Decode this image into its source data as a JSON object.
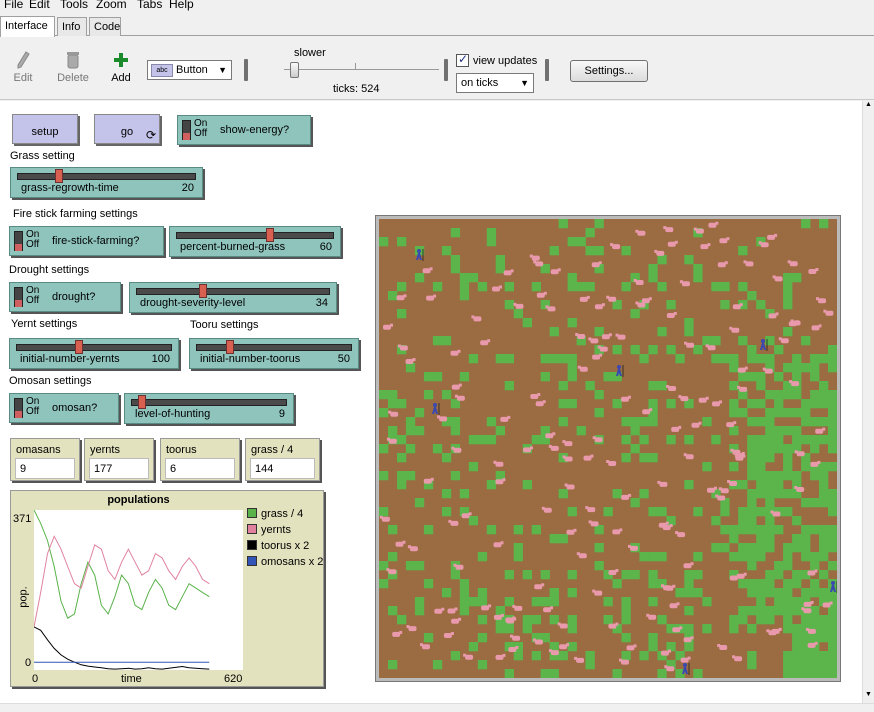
{
  "menu": [
    "File",
    "Edit",
    "Tools",
    "Zoom",
    "Tabs",
    "Help"
  ],
  "tabs": [
    {
      "label": "Interface",
      "active": true
    },
    {
      "label": "Info"
    },
    {
      "label": "Code"
    }
  ],
  "toolbar": {
    "edit_label": "Edit",
    "delete_label": "Delete",
    "add_label": "Add",
    "widget_type": "Button",
    "speed_label": "slower",
    "ticks_text": "ticks: 524",
    "view_updates_label": "view updates",
    "view_updates_checked": true,
    "update_mode": "on ticks",
    "settings_label": "Settings..."
  },
  "buttons": {
    "setup": "setup",
    "go": "go"
  },
  "switches": {
    "show_energy": {
      "label": "show-energy?",
      "on": "On",
      "off": "Off"
    },
    "fire_stick": {
      "label": "fire-stick-farming?",
      "on": "On",
      "off": "Off"
    },
    "drought": {
      "label": "drought?",
      "on": "On",
      "off": "Off"
    },
    "omosan": {
      "label": "omosan?",
      "on": "On",
      "off": "Off"
    }
  },
  "notes": {
    "grass": "Grass setting",
    "fire": "Fire stick farming settings",
    "drought": "Drought settings",
    "yernt": "Yernt settings",
    "tooru": "Tooru settings",
    "omosan": "Omosan settings"
  },
  "sliders": {
    "grass_regrowth": {
      "name": "grass-regrowth-time",
      "value": "20",
      "fraction": 0.22
    },
    "percent_burned": {
      "name": "percent-burned-grass",
      "value": "60",
      "fraction": 0.6
    },
    "drought_severity": {
      "name": "drought-severity-level",
      "value": "34",
      "fraction": 0.34
    },
    "init_yernts": {
      "name": "initial-number-yernts",
      "value": "100",
      "fraction": 0.4
    },
    "init_toorus": {
      "name": "initial-number-toorus",
      "value": "50",
      "fraction": 0.2
    },
    "hunting": {
      "name": "level-of-hunting",
      "value": "9",
      "fraction": 0.05
    }
  },
  "monitors": [
    {
      "name": "omasans",
      "value": "9"
    },
    {
      "name": "yernts",
      "value": "177"
    },
    {
      "name": "toorus",
      "value": "6"
    },
    {
      "name": "grass / 4",
      "value": "144"
    }
  ],
  "plot": {
    "title": "populations",
    "ylabel": "pop.",
    "xlabel": "time",
    "y_max_label": "371",
    "y_min_label": "0",
    "x_min_label": "0",
    "x_max_label": "620",
    "legend": [
      {
        "name": "grass / 4",
        "color": "#59b24a"
      },
      {
        "name": "yernts",
        "color": "#e0829e"
      },
      {
        "name": "toorus x 2",
        "color": "#000000"
      },
      {
        "name": "omosans x 2",
        "color": "#3455b8"
      }
    ]
  },
  "chart_data": {
    "type": "line",
    "ylim": [
      0,
      371
    ],
    "xlim": [
      0,
      620
    ],
    "series": [
      {
        "name": "grass / 4",
        "color": "#59b24a",
        "x": [
          0,
          20,
          40,
          60,
          80,
          100,
          120,
          140,
          160,
          180,
          200,
          220,
          240,
          260,
          280,
          300,
          320,
          340,
          360,
          380,
          400,
          420,
          440,
          460,
          480,
          500,
          520
        ],
        "values": [
          371,
          340,
          300,
          240,
          160,
          120,
          130,
          200,
          250,
          220,
          150,
          130,
          170,
          220,
          200,
          150,
          140,
          180,
          210,
          190,
          150,
          140,
          170,
          200,
          190,
          180,
          170
        ]
      },
      {
        "name": "yernts",
        "color": "#e0829e",
        "x": [
          0,
          20,
          40,
          60,
          80,
          100,
          120,
          140,
          160,
          180,
          200,
          220,
          240,
          260,
          280,
          300,
          320,
          340,
          360,
          380,
          400,
          420,
          440,
          460,
          480,
          500,
          520
        ],
        "values": [
          100,
          180,
          270,
          310,
          280,
          240,
          200,
          190,
          240,
          290,
          280,
          230,
          210,
          250,
          280,
          250,
          220,
          230,
          270,
          260,
          230,
          210,
          240,
          260,
          240,
          210,
          200
        ]
      },
      {
        "name": "toorus x 2",
        "color": "#000000",
        "x": [
          0,
          20,
          40,
          60,
          80,
          100,
          120,
          140,
          160,
          180,
          200,
          220,
          240,
          260,
          280,
          300,
          320,
          340,
          360,
          380,
          400,
          420,
          440,
          460,
          480,
          500,
          520
        ],
        "values": [
          100,
          92,
          70,
          50,
          35,
          25,
          18,
          12,
          9,
          7,
          5,
          3,
          2,
          3,
          4,
          2,
          3,
          5,
          3,
          2,
          4,
          6,
          8,
          5,
          4,
          3,
          2
        ]
      },
      {
        "name": "omosans x 2",
        "color": "#3455b8",
        "x": [
          0,
          520
        ],
        "values": [
          18,
          18
        ]
      }
    ]
  },
  "world": {
    "cols": 51,
    "rows": 51,
    "dirt_color": "#9b6b41",
    "grass_color": "#5bb54b",
    "yernt_color": "#e89aac",
    "tooru_color": "#3a48b0",
    "yernt_count": 177,
    "tooru_count": 6
  }
}
